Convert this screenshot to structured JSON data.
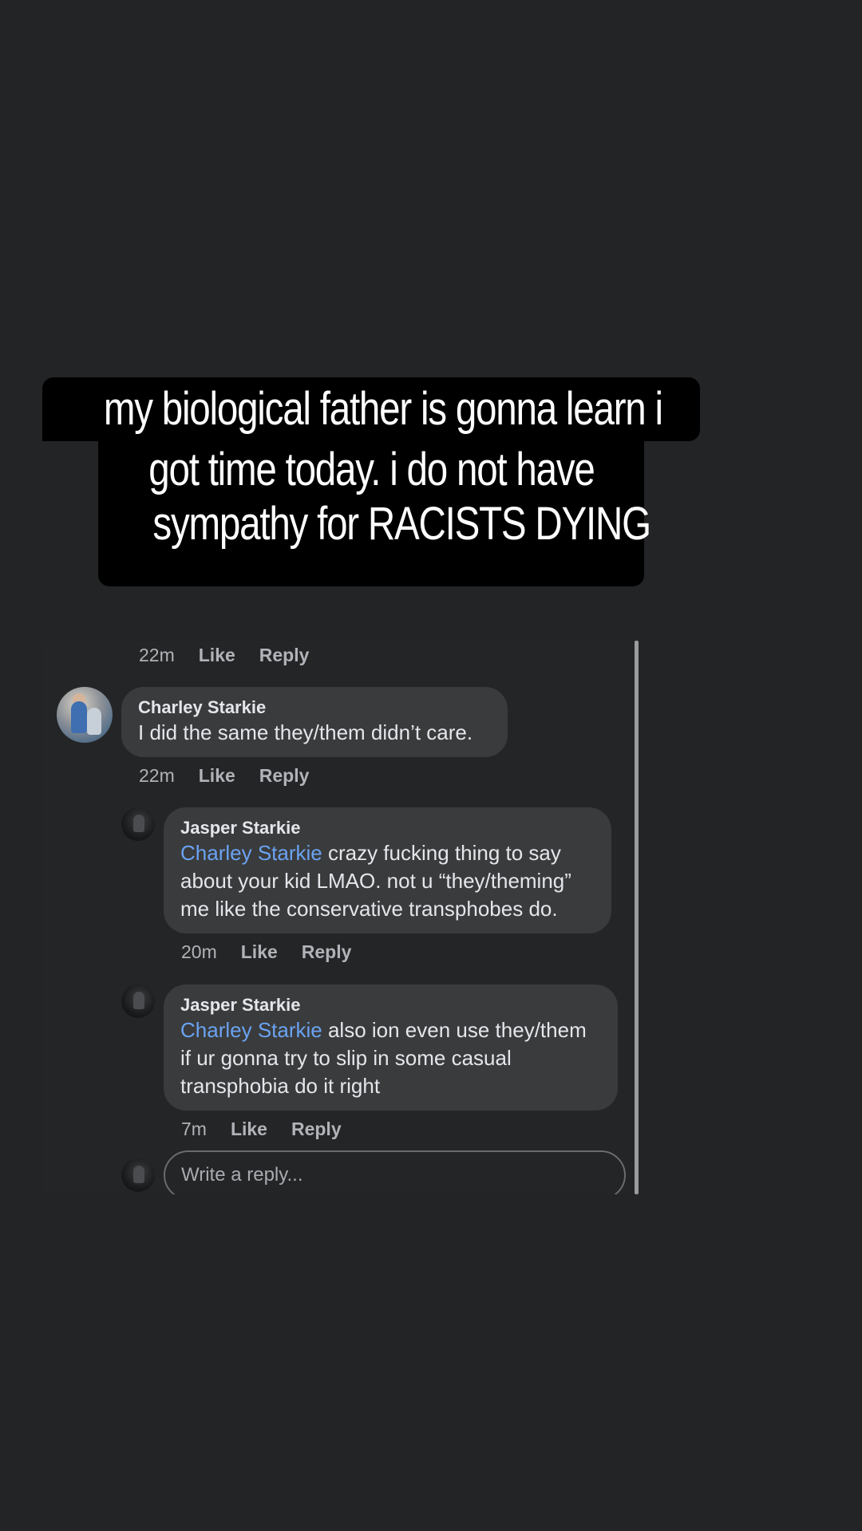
{
  "story": {
    "caption_lines": [
      "my biological father is gonna learn i",
      "got time today. i do not have",
      "sympathy for RACISTS DYING"
    ]
  },
  "comments": {
    "top_meta": {
      "time": "22m",
      "like": "Like",
      "reply": "Reply"
    },
    "items": [
      {
        "author": "Charley Starkie",
        "mention": "",
        "text": "I did the same they/them didn’t care.",
        "time": "22m",
        "like": "Like",
        "reply": "Reply",
        "avatar": "charley-avatar"
      },
      {
        "author": "Jasper Starkie",
        "mention": "Charley Starkie",
        "text": "crazy fucking thing to say about your kid LMAO. not u “they/theming” me like the conservative transphobes do.",
        "time": "20m",
        "like": "Like",
        "reply": "Reply",
        "avatar": "jasper-avatar"
      },
      {
        "author": "Jasper Starkie",
        "mention": "Charley Starkie",
        "text": "also ion even use they/them if ur gonna try to slip in some casual transphobia do it right",
        "time": "7m",
        "like": "Like",
        "reply": "Reply",
        "avatar": "jasper-avatar"
      }
    ],
    "reply_input": {
      "placeholder": "Write a reply..."
    }
  },
  "colors": {
    "background": "#222426",
    "bubble": "#3a3b3c",
    "mention": "#6aa3f2",
    "secondary_text": "#b0b3b8"
  }
}
